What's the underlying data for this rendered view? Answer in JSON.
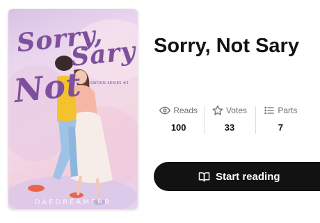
{
  "book": {
    "title": "Sorry, Not Sary",
    "cover": {
      "title_line1": "Sorry,",
      "title_line2": "Sary",
      "title_line3": "Not",
      "series": "SWOON SERIES #1",
      "author": "DAEDREAMERR"
    }
  },
  "stats": [
    {
      "icon": "eye-icon",
      "label": "Reads",
      "value": "100"
    },
    {
      "icon": "star-icon",
      "label": "Votes",
      "value": "33"
    },
    {
      "icon": "list-icon",
      "label": "Parts",
      "value": "7"
    }
  ],
  "actions": {
    "start_reading": {
      "icon": "book-open-icon",
      "label": "Start reading"
    }
  },
  "colors": {
    "button_bg": "#121212",
    "button_text": "#ffffff",
    "stat_label": "#6f6f6f",
    "divider": "#dcdcdc",
    "cover_title": "#7d4f9c"
  }
}
